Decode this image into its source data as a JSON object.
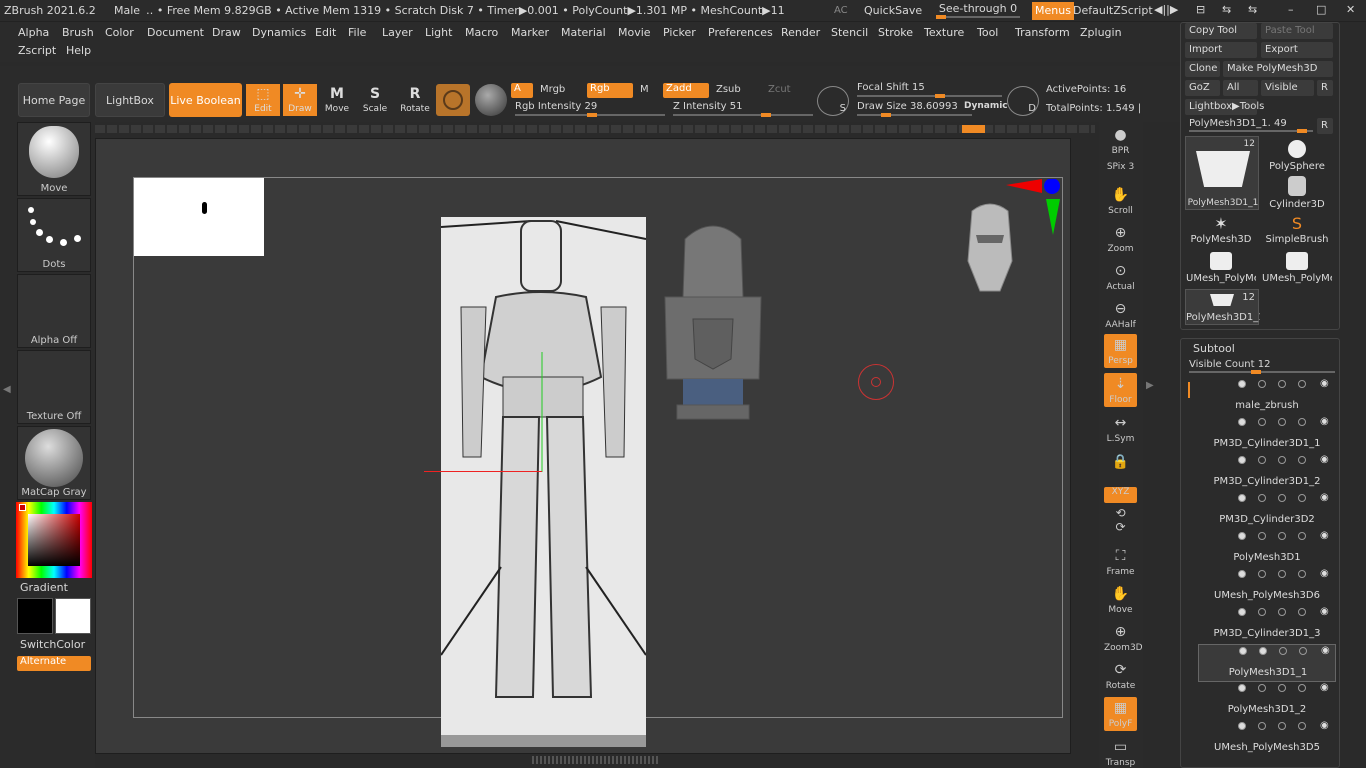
{
  "header": {
    "title": "ZBrush 2021.6.2",
    "project": "Male",
    "stats": "‥ • Free Mem 9.829GB • Active Mem 1319 • Scratch Disk 7 •  Timer▶0.001 • PolyCount▶1.301 MP  • MeshCount▶11",
    "ac": "AC",
    "quicksave": "QuickSave",
    "see_through": "See-through  0",
    "menus": "Menus",
    "script": "DefaultZScript",
    "win_minimize": "–",
    "win_maximize": "□",
    "win_close": "✕"
  },
  "menus": [
    "Alpha",
    "Brush",
    "Color",
    "Document",
    "Draw",
    "Dynamics",
    "Edit",
    "File",
    "Layer",
    "Light",
    "Macro",
    "Marker",
    "Material",
    "Movie",
    "Picker",
    "Preferences",
    "Render",
    "Stencil",
    "Stroke",
    "Texture",
    "Tool",
    "Transform",
    "Zplugin"
  ],
  "menus2": [
    "Zscript",
    "Help"
  ],
  "shelf": {
    "home": "Home Page",
    "lightbox": "LightBox",
    "live_boolean": "Live Boolean",
    "edit": "Edit",
    "draw": "Draw",
    "move": "Move",
    "scale": "Scale",
    "rotate": "Rotate",
    "a": "A",
    "mrgb": "Mrgb",
    "rgb": "Rgb",
    "m": "M",
    "zadd": "Zadd",
    "zsub": "Zsub",
    "zcut": "Zcut",
    "rgb_intensity": "Rgb Intensity 29",
    "z_intensity": "Z Intensity 51",
    "focal_shift": "Focal Shift 15",
    "draw_size": "Draw Size 38.60993",
    "dynamic": "Dynamic",
    "s": "S",
    "d": "D",
    "active_points": "ActivePoints: 16",
    "total_points": "TotalPoints: 1.549 |"
  },
  "left": {
    "move": "Move",
    "dots": "Dots",
    "alpha": "Alpha Off",
    "texture": "Texture Off",
    "matcap": "MatCap Gray",
    "gradient": "Gradient",
    "switchcolor": "SwitchColor",
    "alternate": "Alternate"
  },
  "right_icons": [
    {
      "label": "BPR"
    },
    {
      "label": "SPix 3"
    },
    {
      "label": "Scroll"
    },
    {
      "label": "Zoom"
    },
    {
      "label": "Actual"
    },
    {
      "label": "AAHalf"
    },
    {
      "label": "Persp"
    },
    {
      "label": "Floor"
    },
    {
      "label": "L.Sym"
    },
    {
      "label": "XYZ"
    },
    {
      "label": "Frame"
    },
    {
      "label": "Move"
    },
    {
      "label": "Zoom3D"
    },
    {
      "label": "Rotate"
    },
    {
      "label": "PolyF"
    },
    {
      "label": "Transp"
    }
  ],
  "tool": {
    "copy": "Copy Tool",
    "paste": "Paste Tool",
    "import": "Import",
    "export": "Export",
    "clone": "Clone",
    "make": "Make PolyMesh3D",
    "goz": "GoZ",
    "all": "All",
    "visible": "Visible",
    "r": "R",
    "lightbox_tools": "Lightbox▶Tools",
    "current": "PolyMesh3D1_1. 49",
    "thumb_count": "12",
    "thumbs": [
      "PolyMesh3D1_1",
      "PolySphere",
      "Cylinder3D",
      "PolyMesh3D",
      "SimpleBrush",
      "UMesh_PolyMe",
      "UMesh_PolyMe",
      "PolyMesh3D1_1"
    ],
    "thumb_count2": "12"
  },
  "subtool": {
    "title": "Subtool",
    "visible_count": "Visible Count 12",
    "items": [
      "male_zbrush",
      "PM3D_Cylinder3D1_1",
      "PM3D_Cylinder3D1_2",
      "PM3D_Cylinder3D2",
      "PolyMesh3D1",
      "UMesh_PolyMesh3D6",
      "PM3D_Cylinder3D1_3",
      "PolyMesh3D1_1",
      "PolyMesh3D1_2",
      "UMesh_PolyMesh3D5"
    ]
  }
}
